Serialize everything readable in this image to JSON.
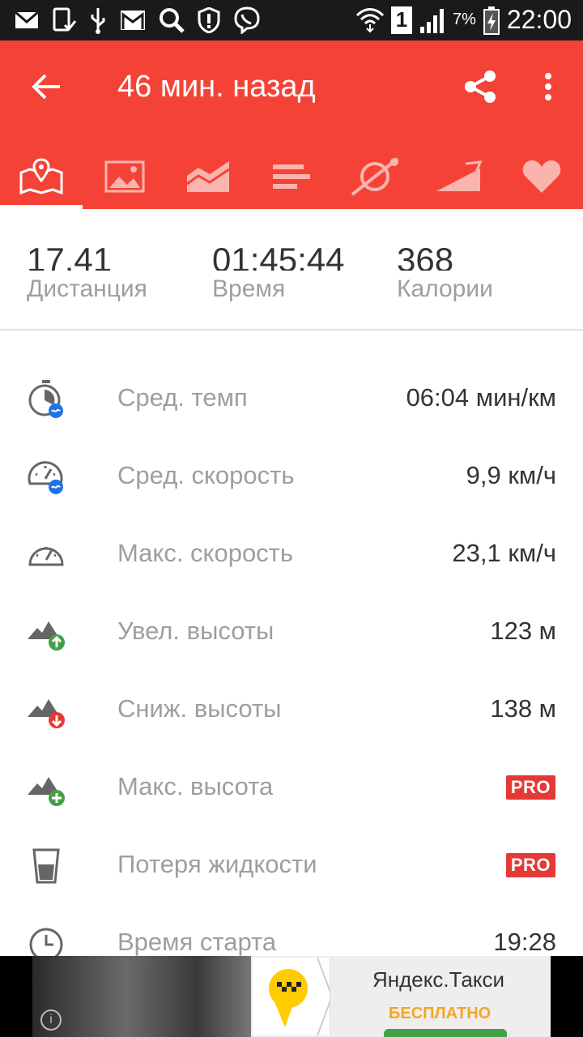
{
  "status_bar": {
    "battery_percent": "7%",
    "sim_slot": "1",
    "time": "22:00",
    "icons": [
      "mail-icon",
      "phone-check-icon",
      "usb-icon",
      "gmail-icon",
      "search-icon",
      "shield-icon",
      "viber-icon",
      "wifi-icon",
      "signal-icon",
      "battery-icon"
    ]
  },
  "app_bar": {
    "title": "46 мин. назад",
    "color": "#f44336",
    "tabs": [
      "map-tab",
      "photos-tab",
      "chart-tab",
      "splits-tab",
      "route-tab",
      "elevation-tab",
      "heart-tab"
    ]
  },
  "summary": {
    "distance": {
      "value": "17.41",
      "label": "Дистанция"
    },
    "time": {
      "value": "01:45:44",
      "label": "Время"
    },
    "calories": {
      "value": "368",
      "label": "Калории"
    }
  },
  "stats": [
    {
      "label": "Сред. темп",
      "value": "06:04 мин/км",
      "icon": "avg-pace-icon"
    },
    {
      "label": "Сред. скорость",
      "value": "9,9 км/ч",
      "icon": "avg-speed-icon"
    },
    {
      "label": "Макс. скорость",
      "value": "23,1 км/ч",
      "icon": "max-speed-icon"
    },
    {
      "label": "Увел. высоты",
      "value": "123 м",
      "icon": "elevation-gain-icon"
    },
    {
      "label": "Сниж. высоты",
      "value": "138 м",
      "icon": "elevation-loss-icon"
    },
    {
      "label": "Макс. высота",
      "badge": "PRO",
      "icon": "max-altitude-icon"
    },
    {
      "label": "Потеря жидкости",
      "badge": "PRO",
      "icon": "fluid-loss-icon"
    },
    {
      "label": "Время старта",
      "value": "19:28",
      "icon": "clock-icon"
    }
  ],
  "ad": {
    "title": "Яндекс.Такси",
    "cta": "БЕСПЛАТНО",
    "info": "i"
  }
}
